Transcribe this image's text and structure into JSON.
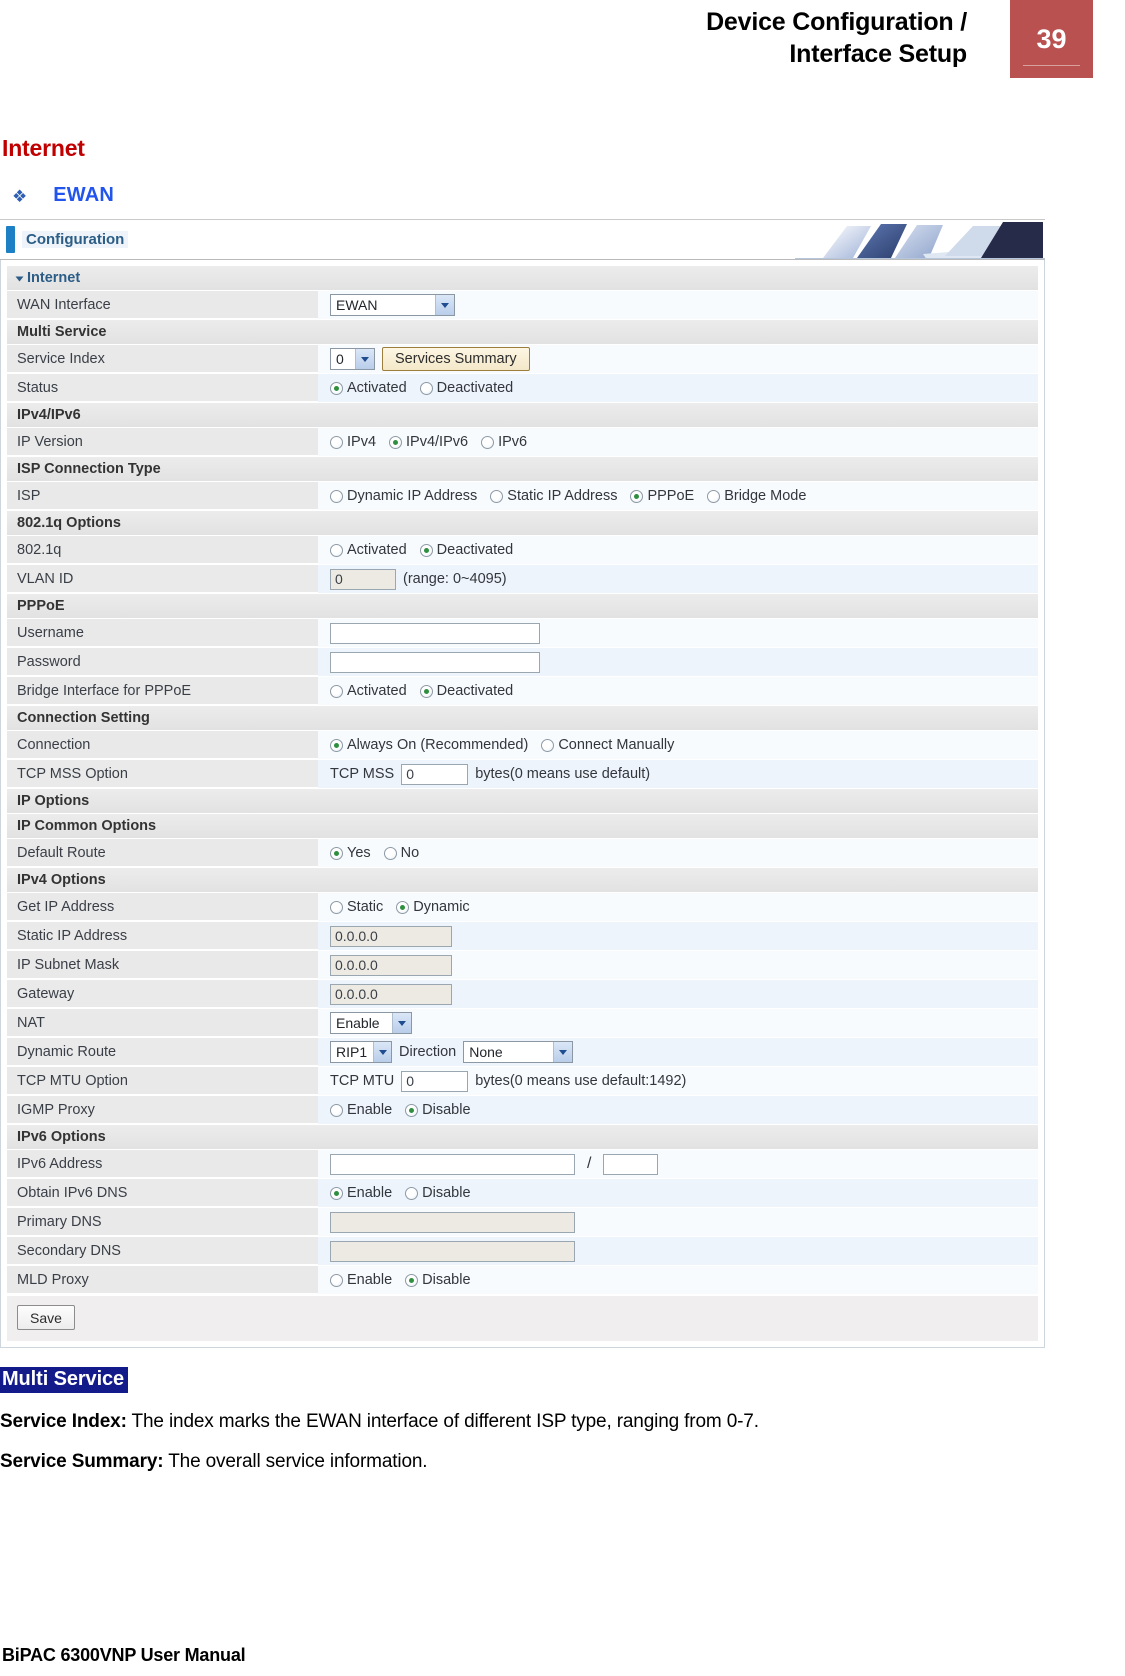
{
  "header": {
    "title_line1": "Device Configuration /",
    "title_line2": "Interface Setup",
    "page_number": "39",
    "accent_color": "#b95151"
  },
  "section": {
    "title": "Internet",
    "title_color": "#c00000",
    "bullet_glyph": "❖",
    "bullet_label": "EWAN",
    "bullet_color": "#2255ee"
  },
  "router_ui": {
    "topbar_label": "Configuration",
    "panel_group": "Internet",
    "rows": {
      "wan_interface": {
        "label": "WAN Interface",
        "value": "EWAN"
      },
      "multi_service_group": "Multi Service",
      "service_index": {
        "label": "Service Index",
        "value": "0",
        "button": "Services Summary"
      },
      "status": {
        "label": "Status",
        "options": [
          "Activated",
          "Deactivated"
        ],
        "selected": "Activated"
      },
      "ipv4_ipv6_group": "IPv4/IPv6",
      "ip_version": {
        "label": "IP Version",
        "options": [
          "IPv4",
          "IPv4/IPv6",
          "IPv6"
        ],
        "selected": "IPv4/IPv6"
      },
      "isp_connection_type_group": "ISP Connection Type",
      "isp": {
        "label": "ISP",
        "options": [
          "Dynamic IP Address",
          "Static IP Address",
          "PPPoE",
          "Bridge Mode"
        ],
        "selected": "PPPoE"
      },
      "dot1q_group": "802.1q Options",
      "dot1q": {
        "label": "802.1q",
        "options": [
          "Activated",
          "Deactivated"
        ],
        "selected": "Deactivated"
      },
      "vlan_id": {
        "label": "VLAN ID",
        "value": "0",
        "hint": "(range: 0~4095)"
      },
      "pppoe_group": "PPPoE",
      "username": {
        "label": "Username",
        "value": ""
      },
      "password": {
        "label": "Password",
        "value": ""
      },
      "bridge_interface_pppoe": {
        "label": "Bridge Interface for PPPoE",
        "options": [
          "Activated",
          "Deactivated"
        ],
        "selected": "Deactivated"
      },
      "connection_setting_group": "Connection Setting",
      "connection": {
        "label": "Connection",
        "options": [
          "Always On (Recommended)",
          "Connect Manually"
        ],
        "selected": "Always On (Recommended)"
      },
      "tcp_mss_option": {
        "label": "TCP MSS Option",
        "prefix": "TCP MSS",
        "value": "0",
        "hint": "bytes(0 means use default)"
      },
      "ip_options_group": "IP Options",
      "ip_common_options_group": "IP Common Options",
      "default_route": {
        "label": "Default Route",
        "options": [
          "Yes",
          "No"
        ],
        "selected": "Yes"
      },
      "ipv4_options_group": "IPv4 Options",
      "get_ip_address": {
        "label": "Get IP Address",
        "options": [
          "Static",
          "Dynamic"
        ],
        "selected": "Dynamic"
      },
      "static_ip_address": {
        "label": "Static IP Address",
        "value": "0.0.0.0"
      },
      "ip_subnet_mask": {
        "label": "IP Subnet Mask",
        "value": "0.0.0.0"
      },
      "gateway": {
        "label": "Gateway",
        "value": "0.0.0.0"
      },
      "nat": {
        "label": "NAT",
        "value": "Enable"
      },
      "dynamic_route": {
        "label": "Dynamic Route",
        "value": "RIP1",
        "direction_label": "Direction",
        "direction_value": "None"
      },
      "tcp_mtu_option": {
        "label": "TCP MTU Option",
        "prefix": "TCP MTU",
        "value": "0",
        "hint": "bytes(0 means use default:1492)"
      },
      "igmp_proxy": {
        "label": "IGMP Proxy",
        "options": [
          "Enable",
          "Disable"
        ],
        "selected": "Disable"
      },
      "ipv6_options_group": "IPv6 Options",
      "ipv6_address": {
        "label": "IPv6 Address",
        "value": "",
        "prefix_value": "",
        "separator": "/"
      },
      "obtain_ipv6_dns": {
        "label": "Obtain IPv6 DNS",
        "options": [
          "Enable",
          "Disable"
        ],
        "selected": "Enable"
      },
      "primary_dns": {
        "label": "Primary DNS",
        "value": ""
      },
      "secondary_dns": {
        "label": "Secondary DNS",
        "value": ""
      },
      "mld_proxy": {
        "label": "MLD Proxy",
        "options": [
          "Enable",
          "Disable"
        ],
        "selected": "Disable"
      }
    },
    "save_button": "Save"
  },
  "body_text": {
    "sub_head": "Multi Service",
    "service_index_term": "Service Index:",
    "service_index_desc": " The index marks the EWAN interface of different ISP type, ranging from 0-7.",
    "service_summary_term": "Service Summary:",
    "service_summary_desc": " The overall service information."
  },
  "footer": {
    "text": "BiPAC 6300VNP User Manual"
  }
}
